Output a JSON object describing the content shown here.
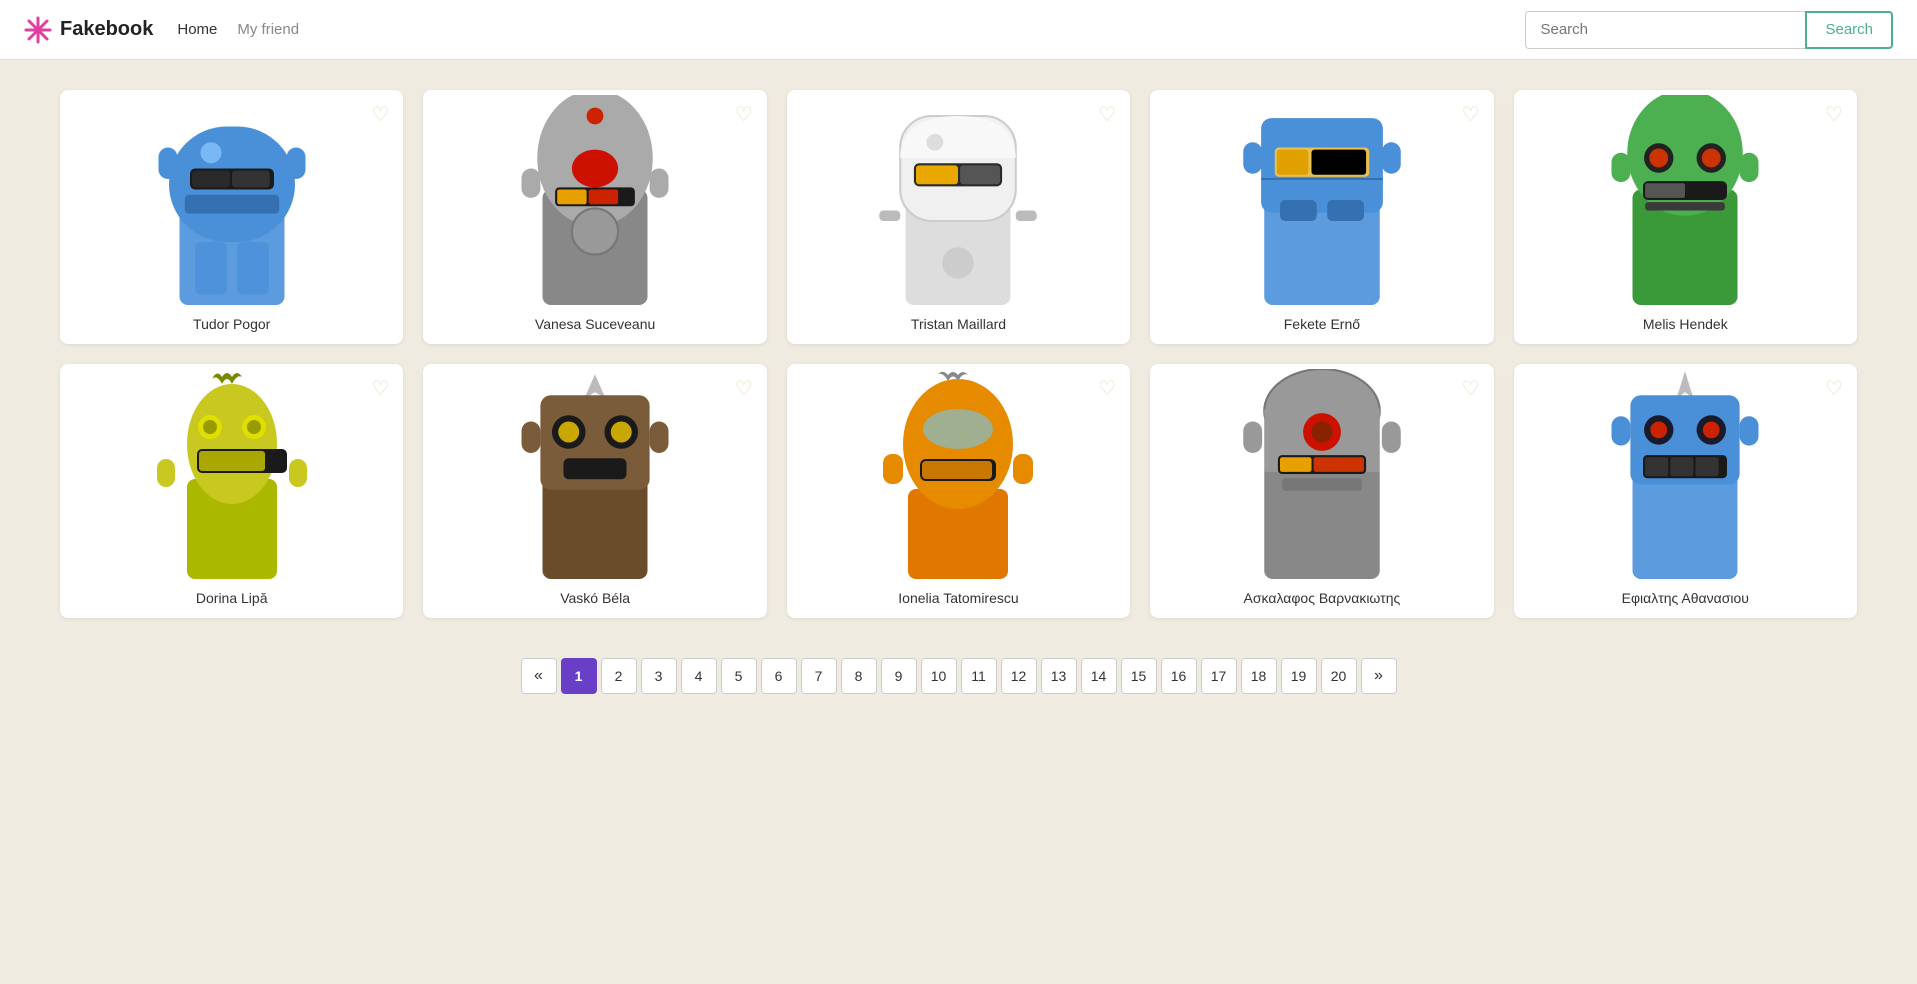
{
  "nav": {
    "logo_text": "Fakebook",
    "home_label": "Home",
    "myfriend_label": "My friend",
    "search_placeholder": "Search",
    "search_btn_label": "Search"
  },
  "cards": [
    {
      "id": 1,
      "name": "Tudor Pogor",
      "color": "#4a90d9",
      "style": "blue-helmet"
    },
    {
      "id": 2,
      "name": "Vanesa Suceveanu",
      "color": "#999",
      "style": "grey-round"
    },
    {
      "id": 3,
      "name": "Tristan Maillard",
      "color": "#e0e0e0",
      "style": "white-visor"
    },
    {
      "id": 4,
      "name": "Fekete Ernő",
      "color": "#4a90d9",
      "style": "blue-square"
    },
    {
      "id": 5,
      "name": "Melis Hendek",
      "color": "#4caf50",
      "style": "green-dome"
    },
    {
      "id": 6,
      "name": "Dorina Lipă",
      "color": "#c8c832",
      "style": "yellow-carrot"
    },
    {
      "id": 7,
      "name": "Vaskó Béla",
      "color": "#7b5c3a",
      "style": "brown-box"
    },
    {
      "id": 8,
      "name": "Ionelia Tatomirescu",
      "color": "#e68a00",
      "style": "orange-bulb"
    },
    {
      "id": 9,
      "name": "Ασκαλαφος Βαρνακιωτης",
      "color": "#888",
      "style": "grey-cylinder"
    },
    {
      "id": 10,
      "name": "Εφιαλτης Αθανασιου",
      "color": "#4a90d9",
      "style": "blue-spike"
    }
  ],
  "pagination": {
    "prev_label": "«",
    "next_label": "»",
    "current": 1,
    "pages": [
      1,
      2,
      3,
      4,
      5,
      6,
      7,
      8,
      9,
      10,
      11,
      12,
      13,
      14,
      15,
      16,
      17,
      18,
      19,
      20
    ]
  }
}
